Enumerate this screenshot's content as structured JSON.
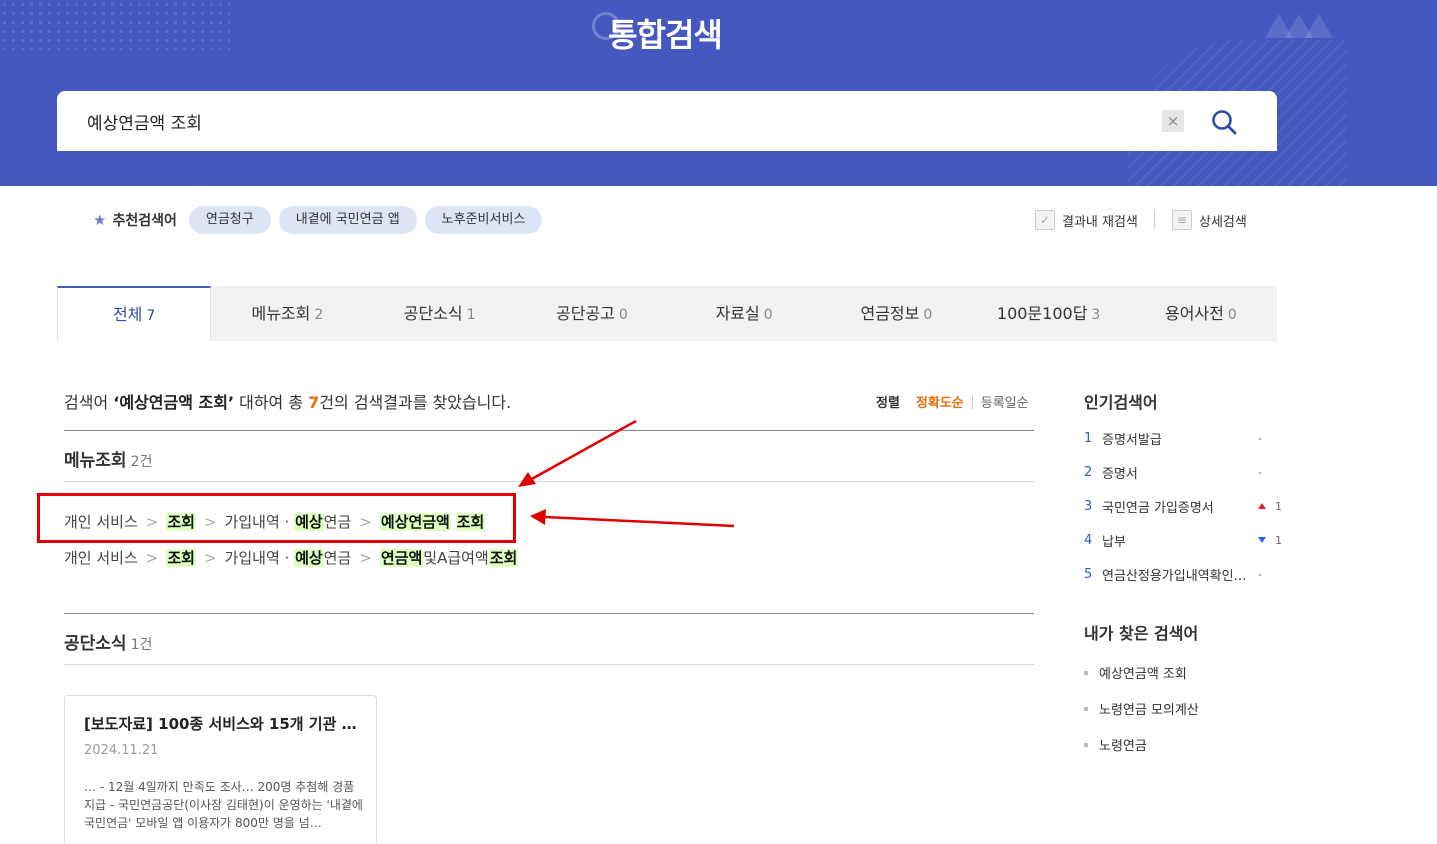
{
  "header": {
    "title": "통합검색",
    "search_value": "예상연금액 조회",
    "clear_label": "×"
  },
  "recommend": {
    "label": "추천검색어",
    "chips": [
      "연금청구",
      "내곁에 국민연금 앱",
      "노후준비서비스"
    ]
  },
  "utils": {
    "research": "결과내 재검색",
    "detail": "상세검색"
  },
  "tabs": [
    {
      "label": "전체",
      "count": "7"
    },
    {
      "label": "메뉴조회",
      "count": "2"
    },
    {
      "label": "공단소식",
      "count": "1"
    },
    {
      "label": "공단공고",
      "count": "0"
    },
    {
      "label": "자료실",
      "count": "0"
    },
    {
      "label": "연금정보",
      "count": "0"
    },
    {
      "label": "100문100답",
      "count": "3"
    },
    {
      "label": "용어사전",
      "count": "0"
    }
  ],
  "summary": {
    "pre": "검색어 ",
    "query": "‘예상연금액 조회’",
    "mid": " 대하여 총 ",
    "count": "7",
    "post": "건의 검색결과를 찾았습니다."
  },
  "sort": {
    "label": "정렬",
    "accuracy": "정확도순",
    "date": "등록일순"
  },
  "menu_section": {
    "title": "메뉴조회",
    "count": "2건",
    "results": [
      {
        "c1": "개인 서비스",
        "c2": "조회",
        "c3a": "가입내역 · ",
        "c3b": "예상",
        "c3c": "연금",
        "c4a": "예상연금액",
        "c4b": " ",
        "c4c": "조회"
      },
      {
        "c1": "개인 서비스",
        "c2": "조회",
        "c3a": "가입내역 · ",
        "c3b": "예상",
        "c3c": "연금",
        "c4a": "연금액",
        "c4b": "및A급여액",
        "c4c": "조회"
      }
    ],
    "gt": ">"
  },
  "news_section": {
    "title": "공단소식",
    "count": "1건",
    "card": {
      "title": "[보도자료] 100종 서비스와 15개 기관 …",
      "date": "2024.11.21",
      "text": "… - 12월 4일까지 만족도 조사… 200명 추첨해 경품 지급 - 국민연금공단(이사장 김태현)이 운영하는 '내곁에 국민연금' 모바일 앱 이용자가 800만 명을 넘…"
    }
  },
  "popular": {
    "title": "인기검색어",
    "items": [
      {
        "rank": "1",
        "word": "증명서발급",
        "change": "-"
      },
      {
        "rank": "2",
        "word": "증명서",
        "change": "-"
      },
      {
        "rank": "3",
        "word": "국민연금 가입증명서",
        "change": "1"
      },
      {
        "rank": "4",
        "word": "납부",
        "change": "1"
      },
      {
        "rank": "5",
        "word": "연금산정용가입내역확인…",
        "change": "-"
      }
    ]
  },
  "my_searches": {
    "title": "내가 찾은 검색어",
    "items": [
      "예상연금액 조회",
      "노령연금 모의계산",
      "노령연금"
    ]
  },
  "colors": {
    "header_bg": "#4458c0",
    "accent_blue": "#2c4ca8",
    "accent_orange": "#e8700e",
    "highlight": "#deffc0",
    "annotation_red": "#e00000"
  }
}
